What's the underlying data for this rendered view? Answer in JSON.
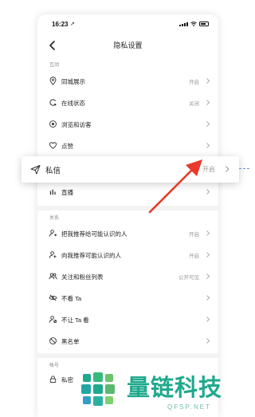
{
  "status_bar": {
    "time": "16:23",
    "location_glyph": "➚"
  },
  "nav": {
    "title": "隐私设置"
  },
  "sections": {
    "interaction": "互动",
    "relations": "关系",
    "account": "帐号"
  },
  "rows": {
    "same_city": {
      "label": "同城展示",
      "value": "开启"
    },
    "online_status": {
      "label": "在线状态",
      "value": "关闭"
    },
    "browse_visitors": {
      "label": "浏览和访客",
      "value": ""
    },
    "likes": {
      "label": "点赞",
      "value": ""
    },
    "live": {
      "label": "直播",
      "value": ""
    },
    "recommend_me": {
      "label": "把我推荐给可能认识的人",
      "value": "开启"
    },
    "recommend_to_me": {
      "label": "向我推荐可能认识的人",
      "value": "开启"
    },
    "follow_fans": {
      "label": "关注和粉丝列表",
      "value": "公开可见"
    },
    "dont_see": {
      "label": "不看 Ta",
      "value": ""
    },
    "dont_let_see": {
      "label": "不让 Ta 看",
      "value": ""
    },
    "blacklist": {
      "label": "黑名单",
      "value": ""
    },
    "private_account": {
      "label": "私密",
      "value": ""
    }
  },
  "highlight": {
    "label": "私信",
    "value": "开启"
  },
  "watermark": {
    "brand": "量链科技",
    "domain": "QFSP.NET"
  },
  "colors": {
    "arrow": "#e8392b",
    "brand": "#1fa98c"
  },
  "icons": {
    "same_city": "location-icon",
    "online_status": "online-status-icon",
    "browse_visitors": "eye-icon",
    "likes": "heart-icon",
    "message": "paper-plane-icon",
    "live": "live-bars-icon"
  }
}
